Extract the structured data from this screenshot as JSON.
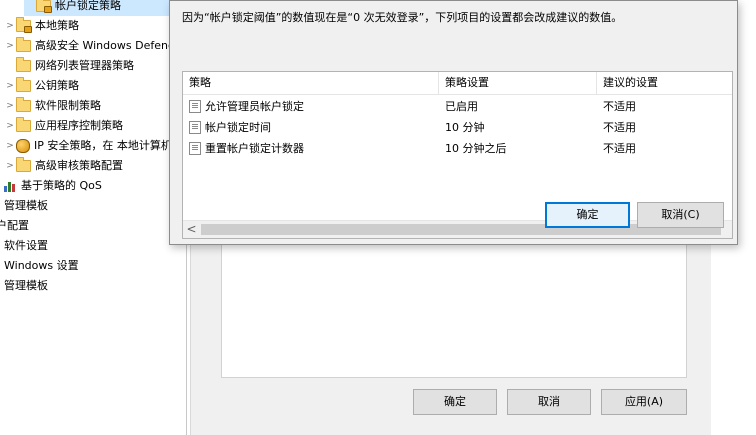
{
  "tree": {
    "items": [
      {
        "label": "帐户锁定策略",
        "icon": "lock-folder-icon",
        "chevron": "",
        "selected": true
      },
      {
        "label": "本地策略",
        "icon": "folder-icon",
        "chevron": ">"
      },
      {
        "label": "高级安全 Windows Defender",
        "icon": "folder-icon",
        "chevron": ">"
      },
      {
        "label": "网络列表管理器策略",
        "icon": "folder-icon",
        "chevron": ""
      },
      {
        "label": "公钥策略",
        "icon": "folder-icon",
        "chevron": ">"
      },
      {
        "label": "软件限制策略",
        "icon": "folder-icon",
        "chevron": ">"
      },
      {
        "label": "应用程序控制策略",
        "icon": "folder-icon",
        "chevron": ">"
      },
      {
        "label": "IP 安全策略，在 本地计算机",
        "icon": "ip-security-icon",
        "chevron": ">"
      },
      {
        "label": "高级审核策略配置",
        "icon": "folder-icon",
        "chevron": ">"
      },
      {
        "label": "基于策略的 QoS",
        "icon": "qos-chart-icon",
        "chevron": ""
      },
      {
        "label": "管理模板",
        "icon": "",
        "chevron": ""
      },
      {
        "label": "户配置",
        "icon": "",
        "chevron": ""
      },
      {
        "label": "软件设置",
        "icon": "",
        "chevron": ""
      },
      {
        "label": "Windows 设置",
        "icon": "",
        "chevron": ""
      },
      {
        "label": "管理模板",
        "icon": "",
        "chevron": ""
      }
    ]
  },
  "modal": {
    "message": "因为“帐户锁定阈值”的数值现在是“0 次无效登录”，下列项目的设置都会改成建议的数值。",
    "columns": [
      "策略",
      "策略设置",
      "建议的设置"
    ],
    "rows": [
      {
        "policy": "允许管理员帐户锁定",
        "setting": "已启用",
        "suggested": "不适用"
      },
      {
        "policy": "帐户锁定时间",
        "setting": "10 分钟",
        "suggested": "不适用"
      },
      {
        "policy": "重置帐户锁定计数器",
        "setting": "10 分钟之后",
        "suggested": "不适用"
      }
    ],
    "ok_label": "确定",
    "cancel_label": "取消(C)",
    "scroll_left": "<"
  },
  "property_dialog": {
    "ok_label": "确定",
    "cancel_label": "取消",
    "apply_label": "应用(A)"
  },
  "colors": {
    "accent": "#0078d7",
    "selection": "#cce8ff",
    "dialog_bg": "#f0f0f0"
  }
}
